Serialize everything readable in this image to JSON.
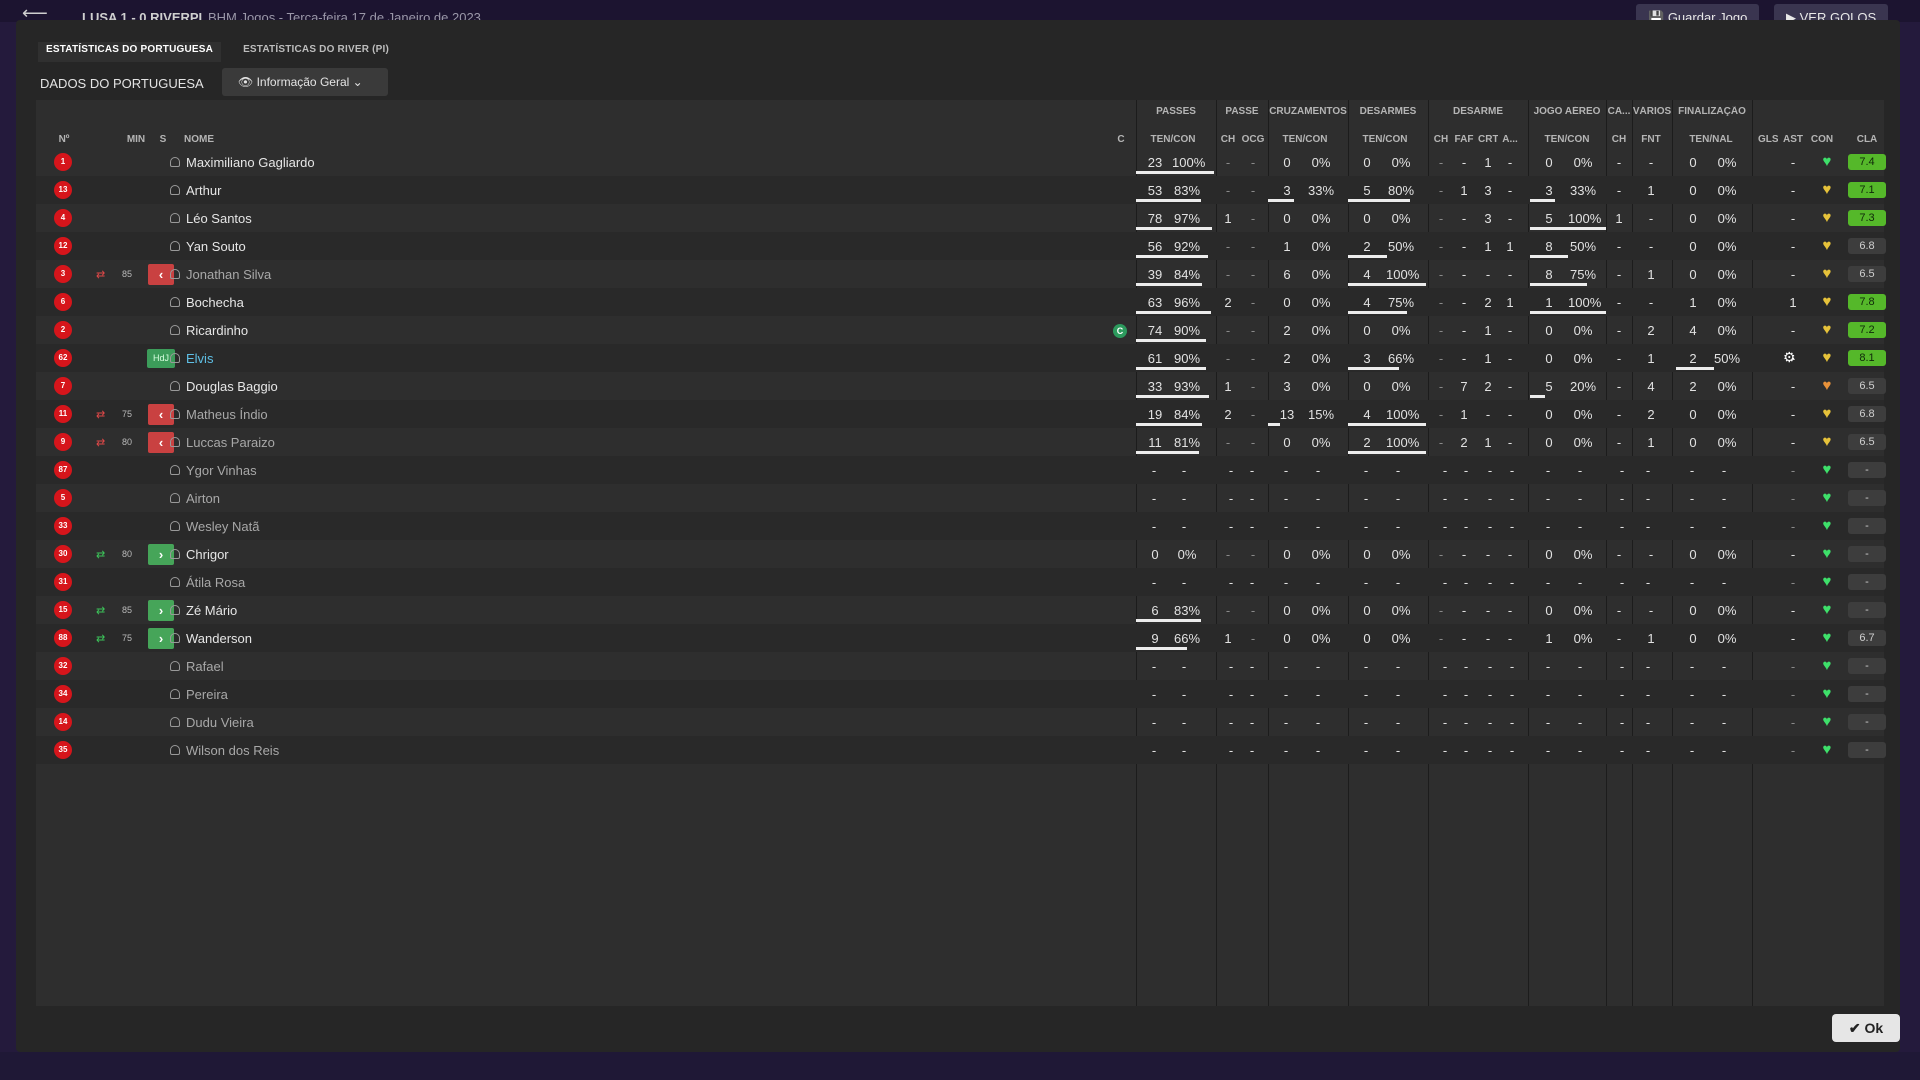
{
  "topbar": {
    "back_glyph": "⟵",
    "score": "LUSA   1 - 0   RIVERPI",
    "crumb": "BHM Jogos  -  Terça-feira 17 de Janeiro de 2023",
    "save_label": "Guardar Jogo",
    "goals_label": "VER GOLOS"
  },
  "tabs": [
    "ESTATÍSTICAS DO PORTUGUESA",
    "ESTATÍSTICAS DO RIVER (PI)"
  ],
  "section": {
    "label": "DADOS DO PORTUGUESA",
    "dropdown": "Informação Geral"
  },
  "group_headers": [
    "PASSES",
    "PASSE",
    "CRUZAMENTOS",
    "DESARMES",
    "DESARME",
    "JOGO AÉREO",
    "CA...",
    "VÁRIOS",
    "FINALIZAÇÃO"
  ],
  "columns": {
    "no": "Nº",
    "min": "MIN",
    "s": "S",
    "name": "NOME",
    "c": "C",
    "passes": "TEN/CON",
    "pch": "CH",
    "pocg": "OCG",
    "cruz": "TEN/CON",
    "des": "TEN/CON",
    "dch": "CH",
    "dfaf": "FAF",
    "dcrt": "CRT",
    "da": "A...",
    "aer": "TEN/CON",
    "cach": "CH",
    "fnt": "FNT",
    "fin": "TEN/NAL",
    "gls": "GLS",
    "ast": "AST",
    "con": "CON",
    "cla": "CLA"
  },
  "players": [
    {
      "no": "1",
      "name": "Maximiliano Gagliardo",
      "min": "",
      "s": "",
      "pt": "23",
      "pp": "100%",
      "pf": 1.0,
      "pch": "-",
      "pocg": "-",
      "ct": "0",
      "cp": "0%",
      "cf": 0,
      "dt": "0",
      "dp": "0%",
      "df": 0,
      "dch": "-",
      "faf": "-",
      "crt": "1",
      "da": "-",
      "at": "0",
      "ap": "0%",
      "af": 0,
      "cach": "-",
      "fnt": "-",
      "ft": "0",
      "fp": "0%",
      "ff": 0,
      "gls": "",
      "ast": "-",
      "heart": "green",
      "cla": "7.4",
      "cls": "good"
    },
    {
      "no": "13",
      "name": "Arthur",
      "min": "",
      "s": "",
      "pt": "53",
      "pp": "83%",
      "pf": 0.83,
      "pch": "-",
      "pocg": "-",
      "ct": "3",
      "cp": "33%",
      "cf": 0.33,
      "dt": "5",
      "dp": "80%",
      "df": 0.8,
      "dch": "-",
      "faf": "1",
      "crt": "3",
      "da": "-",
      "at": "3",
      "ap": "33%",
      "af": 0.33,
      "cach": "-",
      "fnt": "1",
      "ft": "0",
      "fp": "0%",
      "ff": 0,
      "gls": "",
      "ast": "-",
      "heart": "yellow",
      "cla": "7.1",
      "cls": "good"
    },
    {
      "no": "4",
      "name": "Léo Santos",
      "min": "",
      "s": "",
      "pt": "78",
      "pp": "97%",
      "pf": 0.97,
      "pch": "1",
      "pocg": "-",
      "ct": "0",
      "cp": "0%",
      "cf": 0,
      "dt": "0",
      "dp": "0%",
      "df": 0,
      "dch": "-",
      "faf": "-",
      "crt": "3",
      "da": "-",
      "at": "5",
      "ap": "100%",
      "af": 1.0,
      "cach": "1",
      "fnt": "-",
      "ft": "0",
      "fp": "0%",
      "ff": 0,
      "gls": "",
      "ast": "-",
      "heart": "yellow",
      "cla": "7.3",
      "cls": "good"
    },
    {
      "no": "12",
      "name": "Yan Souto",
      "min": "",
      "s": "",
      "pt": "56",
      "pp": "92%",
      "pf": 0.92,
      "pch": "-",
      "pocg": "-",
      "ct": "1",
      "cp": "0%",
      "cf": 0,
      "dt": "2",
      "dp": "50%",
      "df": 0.5,
      "dch": "-",
      "faf": "-",
      "crt": "1",
      "da": "1",
      "at": "8",
      "ap": "50%",
      "af": 0.5,
      "cach": "-",
      "fnt": "-",
      "ft": "0",
      "fp": "0%",
      "ff": 0,
      "gls": "",
      "ast": "-",
      "heart": "yellow",
      "cla": "6.8",
      "cls": "ok"
    },
    {
      "no": "3",
      "name": "Jonathan Silva",
      "min": "85",
      "s": "out",
      "pt": "39",
      "pp": "84%",
      "pf": 0.84,
      "pch": "-",
      "pocg": "-",
      "ct": "6",
      "cp": "0%",
      "cf": 0,
      "dt": "4",
      "dp": "100%",
      "df": 1.0,
      "dch": "-",
      "faf": "-",
      "crt": "-",
      "da": "-",
      "at": "8",
      "ap": "75%",
      "af": 0.75,
      "cach": "-",
      "fnt": "1",
      "ft": "0",
      "fp": "0%",
      "ff": 0,
      "gls": "",
      "ast": "-",
      "heart": "yellow",
      "cla": "6.5",
      "cls": "ok",
      "dim": true
    },
    {
      "no": "6",
      "name": "Bochecha",
      "min": "",
      "s": "",
      "pt": "63",
      "pp": "96%",
      "pf": 0.96,
      "pch": "2",
      "pocg": "-",
      "ct": "0",
      "cp": "0%",
      "cf": 0,
      "dt": "4",
      "dp": "75%",
      "df": 0.75,
      "dch": "-",
      "faf": "-",
      "crt": "2",
      "da": "1",
      "at": "1",
      "ap": "100%",
      "af": 1.0,
      "cach": "-",
      "fnt": "-",
      "ft": "1",
      "fp": "0%",
      "ff": 0,
      "gls": "",
      "ast": "1",
      "heart": "yellow",
      "cla": "7.8",
      "cls": "good"
    },
    {
      "no": "2",
      "name": "Ricardinho",
      "min": "",
      "s": "",
      "cap": "C",
      "pt": "74",
      "pp": "90%",
      "pf": 0.9,
      "pch": "-",
      "pocg": "-",
      "ct": "2",
      "cp": "0%",
      "cf": 0,
      "dt": "0",
      "dp": "0%",
      "df": 0,
      "dch": "-",
      "faf": "-",
      "crt": "1",
      "da": "-",
      "at": "0",
      "ap": "0%",
      "af": 0,
      "cach": "-",
      "fnt": "2",
      "ft": "4",
      "fp": "0%",
      "ff": 0,
      "gls": "",
      "ast": "-",
      "heart": "yellow",
      "cla": "7.2",
      "cls": "good"
    },
    {
      "no": "62",
      "name": "Elvis",
      "min": "",
      "s": "hdj",
      "hdj": "HdJ",
      "hl": true,
      "pt": "61",
      "pp": "90%",
      "pf": 0.9,
      "pch": "-",
      "pocg": "-",
      "ct": "2",
      "cp": "0%",
      "cf": 0,
      "dt": "3",
      "dp": "66%",
      "df": 0.66,
      "dch": "-",
      "faf": "-",
      "crt": "1",
      "da": "-",
      "at": "0",
      "ap": "0%",
      "af": 0,
      "cach": "-",
      "fnt": "1",
      "ft": "2",
      "fp": "50%",
      "ff": 0.5,
      "gls": "gear",
      "ast": "-",
      "heart": "yellow",
      "cla": "8.1",
      "cls": "good"
    },
    {
      "no": "7",
      "name": "Douglas Baggio",
      "min": "",
      "s": "",
      "pt": "33",
      "pp": "93%",
      "pf": 0.93,
      "pch": "1",
      "pocg": "-",
      "ct": "3",
      "cp": "0%",
      "cf": 0,
      "dt": "0",
      "dp": "0%",
      "df": 0,
      "dch": "-",
      "faf": "7",
      "crt": "2",
      "da": "-",
      "at": "5",
      "ap": "20%",
      "af": 0.2,
      "cach": "-",
      "fnt": "4",
      "ft": "2",
      "fp": "0%",
      "ff": 0,
      "gls": "",
      "ast": "-",
      "heart": "orange",
      "cla": "6.5",
      "cls": "ok"
    },
    {
      "no": "11",
      "name": "Matheus Índio",
      "min": "75",
      "s": "out",
      "pt": "19",
      "pp": "84%",
      "pf": 0.84,
      "pch": "2",
      "pocg": "-",
      "ct": "13",
      "cp": "15%",
      "cf": 0.15,
      "dt": "4",
      "dp": "100%",
      "df": 1.0,
      "dch": "-",
      "faf": "1",
      "crt": "-",
      "da": "-",
      "at": "0",
      "ap": "0%",
      "af": 0,
      "cach": "-",
      "fnt": "2",
      "ft": "0",
      "fp": "0%",
      "ff": 0,
      "gls": "",
      "ast": "-",
      "heart": "yellow",
      "cla": "6.8",
      "cls": "ok",
      "dim": true
    },
    {
      "no": "9",
      "name": "Luccas Paraizo",
      "min": "80",
      "s": "out",
      "pt": "11",
      "pp": "81%",
      "pf": 0.81,
      "pch": "-",
      "pocg": "-",
      "ct": "0",
      "cp": "0%",
      "cf": 0,
      "dt": "2",
      "dp": "100%",
      "df": 1.0,
      "dch": "-",
      "faf": "2",
      "crt": "1",
      "da": "-",
      "at": "0",
      "ap": "0%",
      "af": 0,
      "cach": "-",
      "fnt": "1",
      "ft": "0",
      "fp": "0%",
      "ff": 0,
      "gls": "",
      "ast": "-",
      "heart": "yellow",
      "cla": "6.5",
      "cls": "ok",
      "dim": true
    },
    {
      "no": "87",
      "name": "Ygor Vinhas",
      "min": "",
      "s": "",
      "empty": true,
      "sub": true,
      "heart": "green",
      "cla": "-",
      "cls": "ok"
    },
    {
      "no": "5",
      "name": "Airton",
      "min": "",
      "s": "",
      "empty": true,
      "sub": true,
      "heart": "green",
      "cla": "-",
      "cls": "ok"
    },
    {
      "no": "33",
      "name": "Wesley Natã",
      "min": "",
      "s": "",
      "empty": true,
      "sub": true,
      "heart": "green",
      "cla": "-",
      "cls": "ok"
    },
    {
      "no": "30",
      "name": "Chrigor",
      "min": "80",
      "s": "in",
      "pt": "0",
      "pp": "0%",
      "pf": 0,
      "pch": "-",
      "pocg": "-",
      "ct": "0",
      "cp": "0%",
      "cf": 0,
      "dt": "0",
      "dp": "0%",
      "df": 0,
      "dch": "-",
      "faf": "-",
      "crt": "-",
      "da": "-",
      "at": "0",
      "ap": "0%",
      "af": 0,
      "cach": "-",
      "fnt": "-",
      "ft": "0",
      "fp": "0%",
      "ff": 0,
      "gls": "",
      "ast": "-",
      "heart": "green",
      "cla": "-",
      "cls": "ok"
    },
    {
      "no": "31",
      "name": "Átila Rosa",
      "min": "",
      "s": "",
      "empty": true,
      "sub": true,
      "heart": "green",
      "cla": "-",
      "cls": "ok"
    },
    {
      "no": "15",
      "name": "Zé Mário",
      "min": "85",
      "s": "in",
      "pt": "6",
      "pp": "83%",
      "pf": 0.83,
      "pch": "-",
      "pocg": "-",
      "ct": "0",
      "cp": "0%",
      "cf": 0,
      "dt": "0",
      "dp": "0%",
      "df": 0,
      "dch": "-",
      "faf": "-",
      "crt": "-",
      "da": "-",
      "at": "0",
      "ap": "0%",
      "af": 0,
      "cach": "-",
      "fnt": "-",
      "ft": "0",
      "fp": "0%",
      "ff": 0,
      "gls": "",
      "ast": "-",
      "heart": "green",
      "cla": "-",
      "cls": "ok"
    },
    {
      "no": "88",
      "name": "Wanderson",
      "min": "75",
      "s": "in",
      "pt": "9",
      "pp": "66%",
      "pf": 0.66,
      "pch": "1",
      "pocg": "-",
      "ct": "0",
      "cp": "0%",
      "cf": 0,
      "dt": "0",
      "dp": "0%",
      "df": 0,
      "dch": "-",
      "faf": "-",
      "crt": "-",
      "da": "-",
      "at": "1",
      "ap": "0%",
      "af": 0,
      "cach": "-",
      "fnt": "1",
      "ft": "0",
      "fp": "0%",
      "ff": 0,
      "gls": "",
      "ast": "-",
      "heart": "green",
      "cla": "6.7",
      "cls": "ok"
    },
    {
      "no": "32",
      "name": "Rafael",
      "min": "",
      "s": "",
      "empty": true,
      "sub": true,
      "heart": "green",
      "cla": "-",
      "cls": "ok"
    },
    {
      "no": "34",
      "name": "Pereira",
      "min": "",
      "s": "",
      "empty": true,
      "sub": true,
      "heart": "green",
      "cla": "-",
      "cls": "ok"
    },
    {
      "no": "14",
      "name": "Dudu Vieira",
      "min": "",
      "s": "",
      "empty": true,
      "sub": true,
      "heart": "green",
      "cla": "-",
      "cls": "ok"
    },
    {
      "no": "35",
      "name": "Wilson dos Reis",
      "min": "",
      "s": "",
      "empty": true,
      "sub": true,
      "heart": "green",
      "cla": "-",
      "cls": "ok"
    }
  ],
  "colors": {
    "heart_green": "#3ee06a",
    "heart_yellow": "#e6c23a",
    "heart_orange": "#e8923a",
    "rating_good": "#55b82a",
    "badge": "#d6151b"
  },
  "ok_label": "Ok"
}
